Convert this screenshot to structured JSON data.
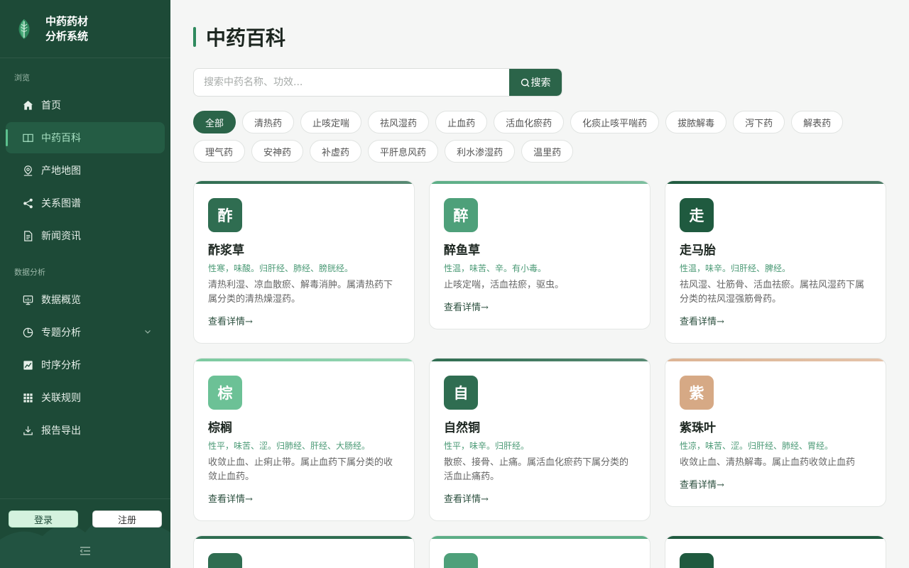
{
  "brand": {
    "title_line1": "中药药材",
    "title_line2": "分析系统"
  },
  "nav": {
    "section_browse": "浏览",
    "section_analysis": "数据分析",
    "items": [
      {
        "label": "首页",
        "icon": "home-icon"
      },
      {
        "label": "中药百科",
        "icon": "book-icon",
        "active": true
      },
      {
        "label": "产地地图",
        "icon": "map-pin-icon"
      },
      {
        "label": "关系图谱",
        "icon": "share-graph-icon"
      },
      {
        "label": "新闻资讯",
        "icon": "document-icon"
      },
      {
        "label": "数据概览",
        "icon": "dashboard-icon"
      },
      {
        "label": "专题分析",
        "icon": "pie-chart-icon"
      },
      {
        "label": "时序分析",
        "icon": "line-chart-icon"
      },
      {
        "label": "关联规则",
        "icon": "grid-icon"
      },
      {
        "label": "报告导出",
        "icon": "download-icon"
      }
    ]
  },
  "footer": {
    "login": "登录",
    "register": "注册"
  },
  "page": {
    "title": "中药百科"
  },
  "search": {
    "placeholder": "搜索中药名称、功效...",
    "button": "搜索"
  },
  "categories": [
    "全部",
    "清热药",
    "止咳定喘",
    "祛风湿药",
    "止血药",
    "活血化瘀药",
    "化痰止咳平喘药",
    "拔脓解毒",
    "泻下药",
    "解表药",
    "理气药",
    "安神药",
    "补虚药",
    "平肝息风药",
    "利水渗湿药",
    "温里药"
  ],
  "active_category": "全部",
  "cards": [
    {
      "char": "酢",
      "name": "酢浆草",
      "props": "性寒，味酸。归肝经、肺经、膀胱经。",
      "desc": "清热利湿、凉血散瘀、解毒消肿。属清热药下属分类的清热燥湿药。",
      "link": "查看详情→",
      "color": "#2f6d51",
      "top": "#2f6d51"
    },
    {
      "char": "醉",
      "name": "醉鱼草",
      "props": "性温，味苦、辛。有小毒。",
      "desc": "止咳定喘，活血祛瘀，驱虫。",
      "link": "查看详情→",
      "color": "#4ea07a",
      "top": "#5cae86"
    },
    {
      "char": "走",
      "name": "走马胎",
      "props": "性温，味辛。归肝经、脾经。",
      "desc": "祛风湿、壮筋骨、活血祛瘀。属祛风湿药下属分类的祛风湿强筋骨药。",
      "link": "查看详情→",
      "color": "#1f5a3f",
      "top": "#1f5a3f"
    },
    {
      "char": "棕",
      "name": "棕榈",
      "props": "性平，味苦、涩。归肺经、肝经、大肠经。",
      "desc": "收敛止血、止痢止带。属止血药下属分类的收敛止血药。",
      "link": "查看详情→",
      "color": "#6cc196",
      "top": "#7ccaa0"
    },
    {
      "char": "自",
      "name": "自然铜",
      "props": "性平，味辛。归肝经。",
      "desc": "散瘀、接骨、止痛。属活血化瘀药下属分类的活血止痛药。",
      "link": "查看详情→",
      "color": "#2f6d51",
      "top": "#2f6d51"
    },
    {
      "char": "紫",
      "name": "紫珠叶",
      "props": "性凉，味苦、涩。归肝经、肺经、胃经。",
      "desc": "收敛止血、清热解毒。属止血药收敛止血药",
      "link": "查看详情→",
      "color": "#d6a985",
      "top": "#ddb494"
    }
  ],
  "partial_cards": [
    {
      "color": "#2f6d51",
      "top": "#2f6d51"
    },
    {
      "color": "#4ea07a",
      "top": "#5cae86"
    },
    {
      "color": "#1f5a3f",
      "top": "#1f5a3f"
    }
  ]
}
